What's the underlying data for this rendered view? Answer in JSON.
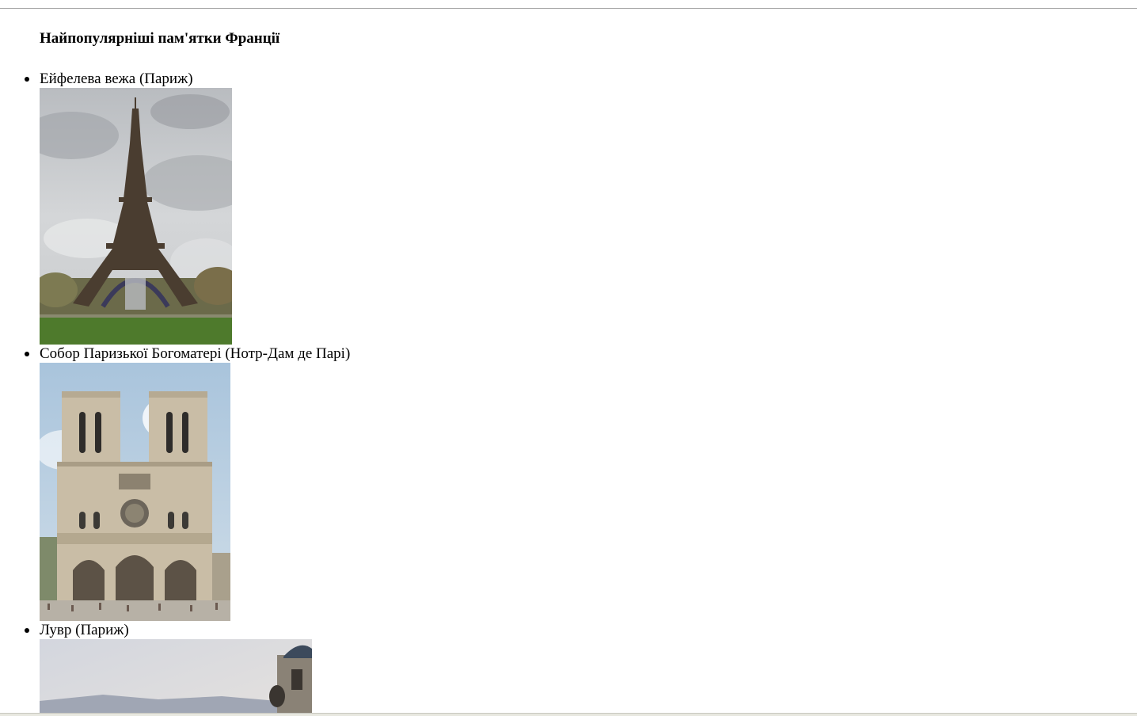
{
  "page": {
    "title": "Найпопулярніші пам'ятки Франції"
  },
  "sights": [
    {
      "label": "Ейфелева вежа (Париж)",
      "image": "eiffel-tower-photo"
    },
    {
      "label": "Собор Паризької Богоматері (Нотр-Дам де Парі)",
      "image": "notre-dame-photo"
    },
    {
      "label": "Лувр (Париж)",
      "image": "louvre-photo"
    }
  ]
}
